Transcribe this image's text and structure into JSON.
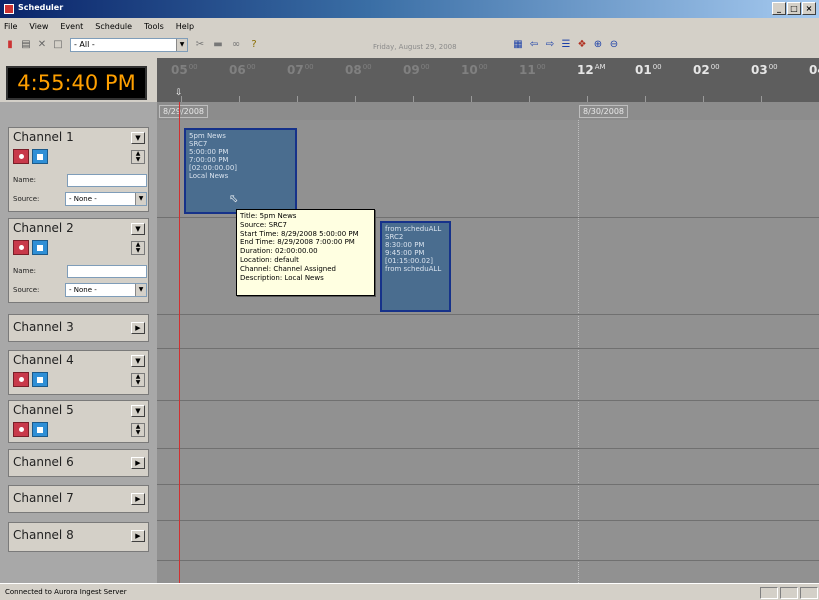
{
  "window": {
    "title": "Scheduler",
    "buttons": [
      "_",
      "□",
      "×"
    ]
  },
  "menu": [
    {
      "label": "File"
    },
    {
      "label": "View"
    },
    {
      "label": "Event"
    },
    {
      "label": "Schedule"
    },
    {
      "label": "Tools"
    },
    {
      "label": "Help"
    }
  ],
  "toolbar": {
    "filter_value": "- All -",
    "date_text": "Friday, August 29, 2008",
    "left_icons": [
      "save-icon",
      "list-icon",
      "delete-icon",
      "window-icon"
    ],
    "mid_icons": [
      "cut-icon",
      "paste-icon",
      "link-icon",
      "help-icon"
    ],
    "right_icons": [
      "grid-icon",
      "move-left-icon",
      "move-right-icon",
      "stack-icon",
      "pin-icon",
      "zoom-in-icon",
      "zoom-out-icon"
    ]
  },
  "clock": "4:55:40 PM",
  "timeline": {
    "hours": [
      {
        "h": "05",
        "sup": "00",
        "dim": true
      },
      {
        "h": "06",
        "sup": "00",
        "dim": true
      },
      {
        "h": "07",
        "sup": "00",
        "dim": true
      },
      {
        "h": "08",
        "sup": "00",
        "dim": true
      },
      {
        "h": "09",
        "sup": "00",
        "dim": true
      },
      {
        "h": "10",
        "sup": "00",
        "dim": true
      },
      {
        "h": "11",
        "sup": "00",
        "dim": true
      },
      {
        "h": "12",
        "sup": "AM",
        "dim": false
      },
      {
        "h": "01",
        "sup": "00",
        "dim": false
      },
      {
        "h": "02",
        "sup": "00",
        "dim": false
      },
      {
        "h": "03",
        "sup": "00",
        "dim": false
      },
      {
        "h": "04",
        "sup": "00",
        "dim": false
      }
    ],
    "now_marker": "⇩",
    "dates": [
      "8/29/2008",
      "8/30/2008"
    ]
  },
  "channels": [
    {
      "name": "Channel 1",
      "expanded": true,
      "name_label": "Name:",
      "source_label": "Source:",
      "source_value": "- None -"
    },
    {
      "name": "Channel 2",
      "expanded": true,
      "name_label": "Name:",
      "source_label": "Source:",
      "source_value": "- None -"
    },
    {
      "name": "Channel 3",
      "expanded": false
    },
    {
      "name": "Channel 4",
      "expanded": "partial"
    },
    {
      "name": "Channel 5",
      "expanded": "partial"
    },
    {
      "name": "Channel 6",
      "expanded": false
    },
    {
      "name": "Channel 7",
      "expanded": false
    },
    {
      "name": "Channel 8",
      "expanded": false
    }
  ],
  "events": [
    {
      "lines": [
        "5pm News",
        "SRC7",
        "5:00:00 PM",
        "7:00:00 PM",
        "[02:00:00.00]",
        "Local News"
      ]
    },
    {
      "lines": [
        "from scheduALL",
        "SRC2",
        "8:30:00 PM",
        "9:45:00 PM",
        "[01:15:00.02]",
        "from scheduALL"
      ]
    }
  ],
  "tooltip": [
    "Title: 5pm News",
    "Source: SRC7",
    "Start Time: 8/29/2008 5:00:00 PM",
    "End Time: 8/29/2008 7:00:00 PM",
    "Duration: 02:00:00.00",
    "Location: default",
    "Channel: Channel Assigned",
    "Description: Local News"
  ],
  "status": {
    "text": "Connected to Aurora Ingest Server"
  },
  "colors": {
    "accent": "#0a246a",
    "clock_digits": "#ffa000",
    "record": "#c8394a",
    "stop": "#2f8fd6",
    "event_fill": "#4a6d8f",
    "now_line": "#d03030"
  }
}
